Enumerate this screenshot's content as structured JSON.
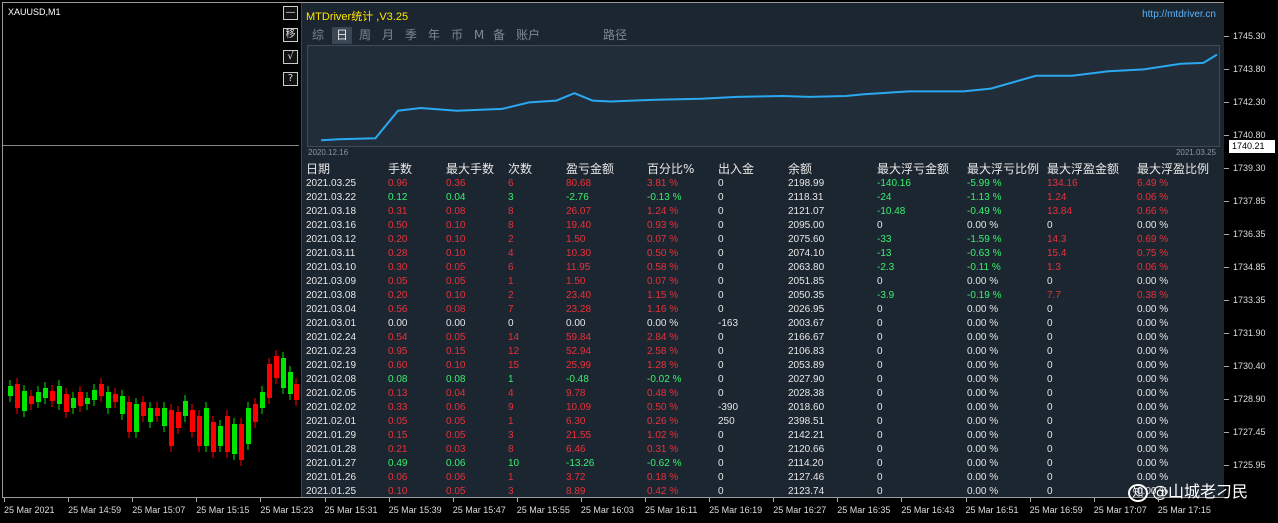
{
  "chart": {
    "symbol": "XAUUSD,M1",
    "price_labels": [
      "1745.30",
      "1743.80",
      "1742.30",
      "1740.80",
      "1739.30",
      "1737.85",
      "1736.35",
      "1734.85",
      "1733.35",
      "1731.90",
      "1730.40",
      "1728.90",
      "1727.45",
      "1725.95"
    ],
    "current_price": "1740.21",
    "time_labels": [
      "25 Mar 2021",
      "25 Mar 14:59",
      "25 Mar 15:07",
      "25 Mar 15:15",
      "25 Mar 15:23",
      "25 Mar 15:31",
      "25 Mar 15:39",
      "25 Mar 15:47",
      "25 Mar 15:55",
      "25 Mar 16:03",
      "25 Mar 16:11",
      "25 Mar 16:19",
      "25 Mar 16:27",
      "25 Mar 16:35",
      "25 Mar 16:43",
      "25 Mar 16:51",
      "25 Mar 16:59",
      "25 Mar 17:07",
      "25 Mar 17:15"
    ],
    "colors": {
      "up": "#00e600",
      "down": "#ff0000",
      "background": "#000000"
    }
  },
  "side_buttons": [
    {
      "icon": "minimize-icon",
      "glyph": "—"
    },
    {
      "icon": "move-icon",
      "glyph": "移"
    },
    {
      "icon": "check-icon",
      "glyph": "√"
    },
    {
      "icon": "help-icon",
      "glyph": "?"
    }
  ],
  "panel": {
    "title": "MTDriver统计 ,V3.25",
    "link": "http://mtdriver.cn",
    "tabs": [
      "综",
      "日",
      "周",
      "月",
      "季",
      "年",
      "币",
      "M",
      "备",
      "账户",
      "路径"
    ],
    "active_tab": "日",
    "equity_start": "2020.12.16",
    "equity_end": "2021.03.25",
    "headers": [
      "日期",
      "手数",
      "最大手数",
      "次数",
      "盈亏金额",
      "百分比%",
      "出入金",
      "余额",
      "最大浮亏金额",
      "最大浮亏比例",
      "最大浮盈金额",
      "最大浮盈比例"
    ],
    "rows": [
      [
        "2021.03.25",
        "0.96",
        "0.36",
        "6",
        "80.68",
        "3.81 %",
        "0",
        "2198.99",
        "-140.16",
        "-5.99 %",
        "134.16",
        "6.49 %"
      ],
      [
        "2021.03.22",
        "0.12",
        "0.04",
        "3",
        "-2.76",
        "-0.13 %",
        "0",
        "2118.31",
        "-24",
        "-1.13 %",
        "1.24",
        "0.06 %"
      ],
      [
        "2021.03.18",
        "0.31",
        "0.08",
        "8",
        "26.07",
        "1.24 %",
        "0",
        "2121.07",
        "-10.48",
        "-0.49 %",
        "13.84",
        "0.66 %"
      ],
      [
        "2021.03.16",
        "0.50",
        "0.10",
        "8",
        "19.40",
        "0.93 %",
        "0",
        "2095.00",
        "0",
        "0.00 %",
        "0",
        "0.00 %"
      ],
      [
        "2021.03.12",
        "0.20",
        "0.10",
        "2",
        "1.50",
        "0.07 %",
        "0",
        "2075.60",
        "-33",
        "-1.59 %",
        "14.3",
        "0.69 %"
      ],
      [
        "2021.03.11",
        "0.28",
        "0.10",
        "4",
        "10.30",
        "0.50 %",
        "0",
        "2074.10",
        "-13",
        "-0.63 %",
        "15.4",
        "0.75 %"
      ],
      [
        "2021.03.10",
        "0.30",
        "0.05",
        "6",
        "11.95",
        "0.58 %",
        "0",
        "2063.80",
        "-2.3",
        "-0.11 %",
        "1.3",
        "0.06 %"
      ],
      [
        "2021.03.09",
        "0.05",
        "0.05",
        "1",
        "1.50",
        "0.07 %",
        "0",
        "2051.85",
        "0",
        "0.00 %",
        "0",
        "0.00 %"
      ],
      [
        "2021.03.08",
        "0.20",
        "0.10",
        "2",
        "23.40",
        "1.15 %",
        "0",
        "2050.35",
        "-3.9",
        "-0.19 %",
        "7.7",
        "0.38 %"
      ],
      [
        "2021.03.04",
        "0.56",
        "0.08",
        "7",
        "23.28",
        "1.16 %",
        "0",
        "2026.95",
        "0",
        "0.00 %",
        "0",
        "0.00 %"
      ],
      [
        "2021.03.01",
        "0.00",
        "0.00",
        "0",
        "0.00",
        "0.00 %",
        "-163",
        "2003.67",
        "0",
        "0.00 %",
        "0",
        "0.00 %"
      ],
      [
        "2021.02.24",
        "0.54",
        "0.05",
        "14",
        "59.84",
        "2.84 %",
        "0",
        "2166.67",
        "0",
        "0.00 %",
        "0",
        "0.00 %"
      ],
      [
        "2021.02.23",
        "0.95",
        "0.15",
        "12",
        "52.94",
        "2.58 %",
        "0",
        "2106.83",
        "0",
        "0.00 %",
        "0",
        "0.00 %"
      ],
      [
        "2021.02.19",
        "0.60",
        "0.10",
        "15",
        "25.99",
        "1.28 %",
        "0",
        "2053.89",
        "0",
        "0.00 %",
        "0",
        "0.00 %"
      ],
      [
        "2021.02.08",
        "0.08",
        "0.08",
        "1",
        "-0.48",
        "-0.02 %",
        "0",
        "2027.90",
        "0",
        "0.00 %",
        "0",
        "0.00 %"
      ],
      [
        "2021.02.05",
        "0.13",
        "0.04",
        "4",
        "9.78",
        "0.48 %",
        "0",
        "2028.38",
        "0",
        "0.00 %",
        "0",
        "0.00 %"
      ],
      [
        "2021.02.02",
        "0.33",
        "0.06",
        "9",
        "10.09",
        "0.50 %",
        "-390",
        "2018.60",
        "0",
        "0.00 %",
        "0",
        "0.00 %"
      ],
      [
        "2021.02.01",
        "0.05",
        "0.05",
        "1",
        "6.30",
        "0.26 %",
        "250",
        "2398.51",
        "0",
        "0.00 %",
        "0",
        "0.00 %"
      ],
      [
        "2021.01.29",
        "0.15",
        "0.05",
        "3",
        "21.55",
        "1.02 %",
        "0",
        "2142.21",
        "0",
        "0.00 %",
        "0",
        "0.00 %"
      ],
      [
        "2021.01.28",
        "0.21",
        "0.03",
        "8",
        "6.46",
        "0.31 %",
        "0",
        "2120.66",
        "0",
        "0.00 %",
        "0",
        "0.00 %"
      ],
      [
        "2021.01.27",
        "0.49",
        "0.06",
        "10",
        "-13.26",
        "-0.62 %",
        "0",
        "2114.20",
        "0",
        "0.00 %",
        "0",
        "0.00 %"
      ],
      [
        "2021.01.26",
        "0.06",
        "0.06",
        "1",
        "3.72",
        "0.18 %",
        "0",
        "2127.46",
        "0",
        "0.00 %",
        "0",
        "0.00 %"
      ],
      [
        "2021.01.25",
        "0.10",
        "0.05",
        "3",
        "8.89",
        "0.42 %",
        "0",
        "2123.74",
        "0",
        "0.00 %",
        "0",
        "0.00 %"
      ]
    ],
    "colors": {
      "profit": "#e8313a",
      "loss": "#39f06f",
      "neutral": "#e6e6e6",
      "equity_line": "#2aa8f0",
      "title": "#ffe600",
      "link": "#5ab3ff"
    }
  },
  "watermark": "@山城老刁民",
  "watermark_icon": "zhihu-icon"
}
